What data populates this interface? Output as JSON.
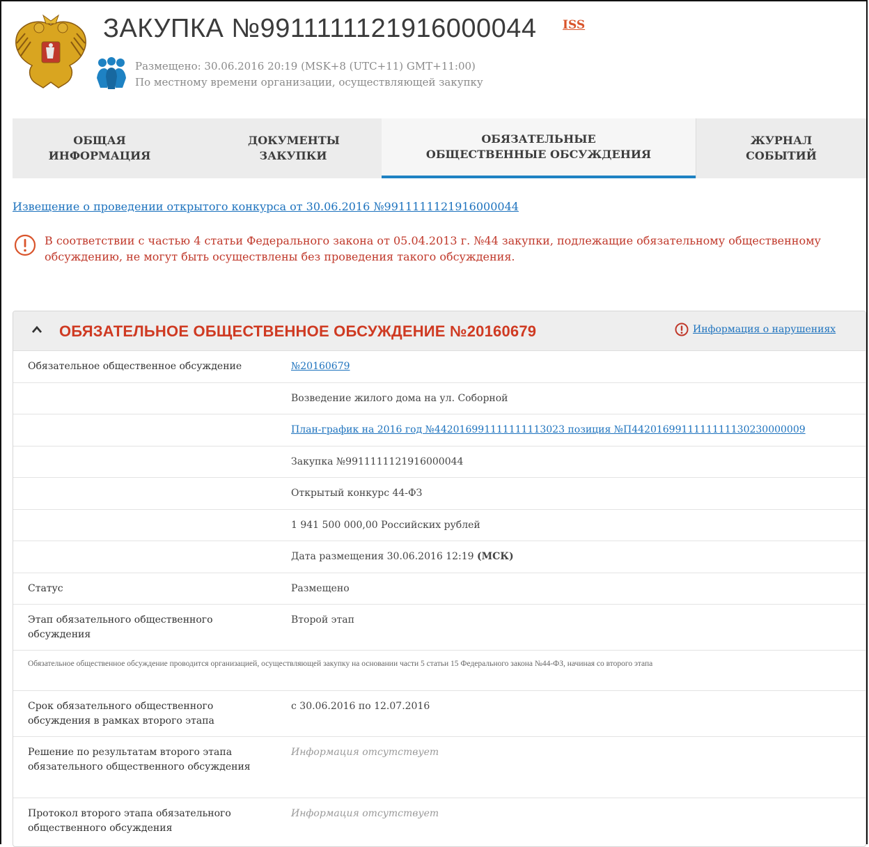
{
  "header": {
    "title": "ЗАКУПКА №9911111121916000044",
    "iss_label": "ISS",
    "posted": "Размещено: 30.06.2016 20:19 (MSK+8 (UTC+11) GMT+11:00)",
    "timezone_note": "По местному времени организации, осуществляющей закупку"
  },
  "tabs": [
    {
      "label": "ОБЩАЯ ИНФОРМАЦИЯ",
      "active": false
    },
    {
      "label": "ДОКУМЕНТЫ ЗАКУПКИ",
      "active": false
    },
    {
      "label": "ОБЯЗАТЕЛЬНЫЕ ОБЩЕСТВЕННЫЕ ОБСУЖДЕНИЯ",
      "active": true
    },
    {
      "label": "ЖУРНАЛ СОБЫТИЙ",
      "active": false
    }
  ],
  "notice_link": "Извещение о проведении открытого конкурса от 30.06.2016 №9911111121916000044",
  "warning": "В соответствии с частью 4 статьи Федерального закона от 05.04.2013 г. №44 закупки, подлежащие обязательному общественному обсуждению, не могут быть осуществлены без проведения такого обсуждения.",
  "panel": {
    "title": "ОБЯЗАТЕЛЬНОЕ ОБЩЕСТВЕННОЕ ОБСУЖДЕНИЕ №20160679",
    "violations_link": "Информация о нарушениях",
    "rows": [
      {
        "label": "Обязательное общественное обсуждение",
        "value": "№20160679",
        "link": true
      },
      {
        "label": "",
        "value": "Возведение жилого дома на ул. Соборной"
      },
      {
        "label": "",
        "value": "План-график на 2016 год №442016991111111113023 позиция №П4420169911111111130230000009",
        "link": true
      },
      {
        "label": "",
        "value": "Закупка №9911111121916000044"
      },
      {
        "label": "",
        "value": "Открытый конкурс 44-ФЗ"
      },
      {
        "label": "",
        "value": "1 941 500 000,00 Российских рублей"
      },
      {
        "label": "",
        "value": "Дата размещения 30.06.2016 12:19",
        "bold_suffix": "(МСК)"
      },
      {
        "label": "Статус",
        "value": "Размещено"
      },
      {
        "label": "Этап обязательного общественного обсуждения",
        "value": "Второй этап"
      },
      {
        "note": "Обязательное общественное обсуждение проводится организацией, осуществляющей закупку на основании части 5 статьи 15 Федерального закона №44-ФЗ, начиная со второго этапа"
      },
      {
        "label": "Срок обязательного общественного обсуждения в рамках второго этапа",
        "value": "с 30.06.2016 по 12.07.2016"
      },
      {
        "label": "Решение по результатам второго этапа обязательного общественного обсуждения",
        "value": "Информация отсутствует",
        "missing": true
      },
      {
        "label": "Протокол второго этапа обязательного общественного обсуждения",
        "value": "Информация отсутствует",
        "missing": true
      }
    ]
  },
  "colors": {
    "accent_blue": "#1e82c3",
    "warning_red": "#c0392b",
    "panel_title_red": "#cf3a22"
  }
}
